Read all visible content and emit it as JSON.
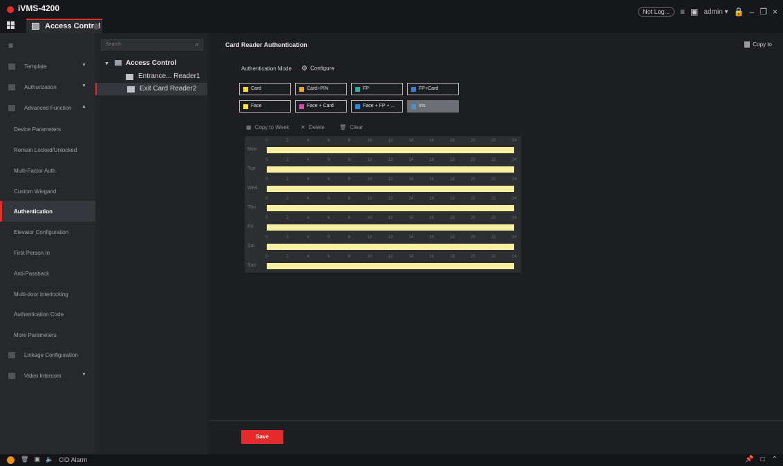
{
  "window": {
    "app_title": "iVMS-4200",
    "tab_label": "Access Control",
    "not_logged": "Not Log...",
    "user": "admin",
    "user_caret": "▾",
    "list_icon": "≡",
    "window_icon": "▣",
    "lock_icon": "🔒",
    "minimize": "–",
    "restore": "❐",
    "close": "×"
  },
  "sidebar": {
    "toggle": "≡",
    "top_items": [
      {
        "label": "Template",
        "chevron": "▼"
      },
      {
        "label": "Authorization",
        "chevron": "▼"
      },
      {
        "label": "Advanced Function",
        "chevron": "▲"
      }
    ],
    "sub_items": [
      {
        "label": "Device Parameters"
      },
      {
        "label": "Remain Locked/Unlocked"
      },
      {
        "label": "Multi-Factor Auth."
      },
      {
        "label": "Custom Wiegand"
      },
      {
        "label": "Authentication"
      },
      {
        "label": "Elevator Configuration"
      },
      {
        "label": "First Person In"
      },
      {
        "label": "Anti-Passback"
      },
      {
        "label": "Multi-door Interlocking"
      },
      {
        "label": "Authentication Code"
      },
      {
        "label": "More Parameters"
      }
    ],
    "bottom_items": [
      {
        "label": "Linkage Configuration",
        "chevron": ""
      },
      {
        "label": "Video Intercom",
        "chevron": "▼"
      }
    ]
  },
  "tree": {
    "search_placeholder": "Search",
    "search_icon": "⌕",
    "root_arrow": "▼",
    "root_label": "Access Control",
    "nodes": [
      {
        "label": "Entrance... Reader1"
      },
      {
        "label": "Exit Card Reader2"
      }
    ]
  },
  "main": {
    "title": "Card Reader Authentication",
    "copy_to": "Copy to",
    "auth_mode_label": "Authentication Mode",
    "configure_icon": "⚙",
    "configure_label": "Configure",
    "modes": [
      {
        "label": "Card",
        "color": "#f5d63b"
      },
      {
        "label": "Card+PIN",
        "color": "#f3a01b"
      },
      {
        "label": "FP",
        "color": "#3aa9a0"
      },
      {
        "label": "FP+Card",
        "color": "#3b7fd6"
      },
      {
        "label": "Face",
        "color": "#f5e23b"
      },
      {
        "label": "Face + Card",
        "color": "#e23fb2"
      },
      {
        "label": "Face + FP + ...",
        "color": "#2a8bd8"
      },
      {
        "label": "Iris",
        "color": "#4a8fd0"
      }
    ],
    "tools": [
      {
        "icon": "▦",
        "label": "Copy to Week"
      },
      {
        "icon": "✕",
        "label": "Delete"
      },
      {
        "icon": "🗑",
        "label": "Clear"
      }
    ],
    "schedule": {
      "ticks": [
        "0",
        "2",
        "4",
        "6",
        "8",
        "10",
        "12",
        "14",
        "16",
        "18",
        "20",
        "22",
        "24"
      ],
      "days": [
        {
          "label": "Mon",
          "start": 0,
          "end": 24
        },
        {
          "label": "Tue",
          "start": 0,
          "end": 24
        },
        {
          "label": "Wed",
          "start": 0,
          "end": 24
        },
        {
          "label": "Thu",
          "start": 0,
          "end": 24
        },
        {
          "label": "Fri",
          "start": 0,
          "end": 24
        },
        {
          "label": "Sat",
          "start": 0,
          "end": 24
        },
        {
          "label": "Sun",
          "start": 0,
          "end": 24
        }
      ],
      "fill_color": "#f7f0a0"
    },
    "save_label": "Save"
  },
  "statusbar": {
    "icons": [
      "🗑",
      "▣",
      "🔈"
    ],
    "alarm_label": "CID Alarm",
    "right_icons": [
      "📌",
      "□",
      "⌃"
    ]
  }
}
